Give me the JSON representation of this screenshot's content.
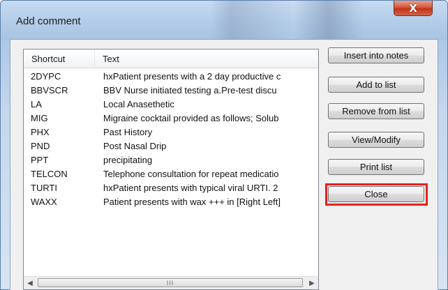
{
  "window": {
    "title": "Add comment"
  },
  "controls": {
    "close_glyph": "X"
  },
  "list": {
    "columns": [
      "Shortcut",
      "Text"
    ],
    "rows": [
      {
        "shortcut": "2DYPC",
        "text": "hxPatient presents with a 2 day productive c"
      },
      {
        "shortcut": "BBVSCR",
        "text": "BBV Nurse initiated testing   a.Pre-test discu"
      },
      {
        "shortcut": "LA",
        "text": "Local Anasethetic"
      },
      {
        "shortcut": "MIG",
        "text": "Migraine cocktail provided as follows;  Solub"
      },
      {
        "shortcut": "PHX",
        "text": "Past History"
      },
      {
        "shortcut": "PND",
        "text": "Post Nasal Drip"
      },
      {
        "shortcut": "PPT",
        "text": "precipitating"
      },
      {
        "shortcut": "TELCON",
        "text": "Telephone consultation for repeat medicatio"
      },
      {
        "shortcut": "TURTI",
        "text": "hxPatient presents with typical viral URTI. 2"
      },
      {
        "shortcut": "WAXX",
        "text": "Patient presents with wax +++ in [Right Left]"
      }
    ],
    "scrollbar": {
      "left_arrow": "◀",
      "right_arrow": "▶",
      "thumb_grip": "III"
    }
  },
  "buttons": {
    "insert": "Insert into notes",
    "add": "Add to list",
    "remove": "Remove from list",
    "view": "View/Modify",
    "print": "Print list",
    "close": "Close"
  },
  "highlight_color": "#e8201c"
}
